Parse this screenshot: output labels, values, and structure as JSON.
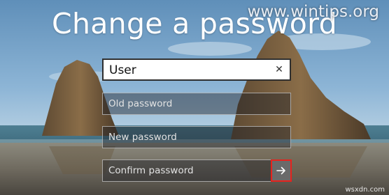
{
  "title": "Change a password",
  "watermark_top": "www.wintips.org",
  "watermark_bottom": "wsxdn.com",
  "form": {
    "user_value": "User",
    "old_password_placeholder": "Old password",
    "new_password_placeholder": "New password",
    "confirm_password_placeholder": "Confirm password",
    "clear_icon": "close-icon",
    "submit_icon": "arrow-right-icon"
  },
  "colors": {
    "submit_border": "#e8221d",
    "submit_bg": "#6a6a6a",
    "text": "#ffffff"
  }
}
